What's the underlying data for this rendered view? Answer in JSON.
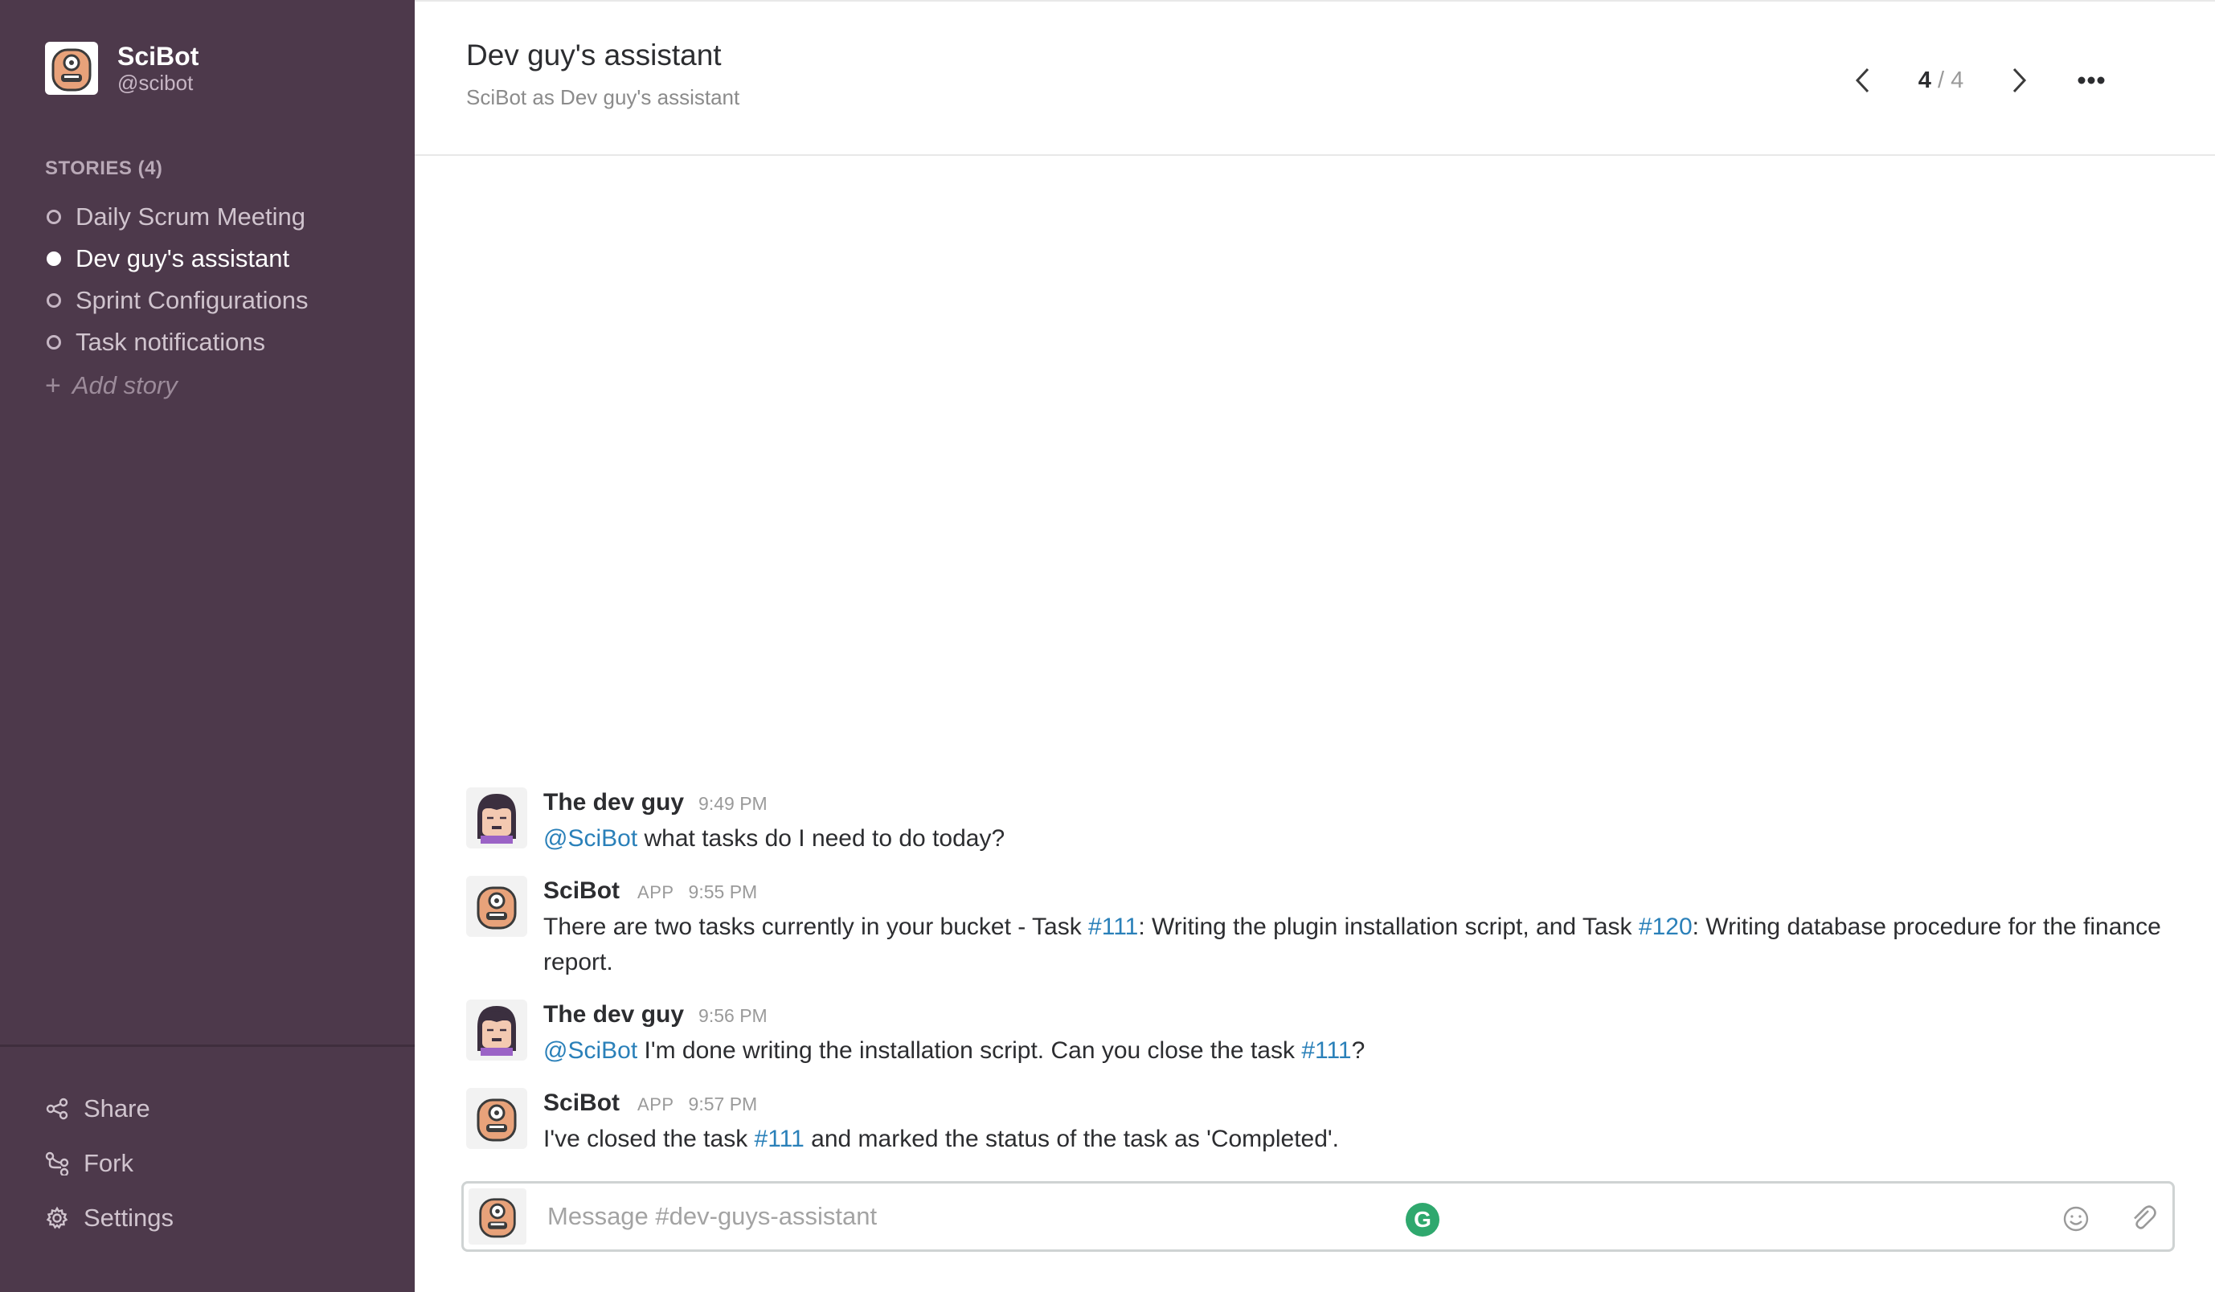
{
  "brand": {
    "name": "SciBot",
    "handle": "@scibot"
  },
  "sidebar": {
    "stories_heading": "STORIES (4)",
    "stories": [
      {
        "label": "Daily Scrum Meeting",
        "active": false
      },
      {
        "label": "Dev guy's assistant",
        "active": true
      },
      {
        "label": "Sprint Configurations",
        "active": false
      },
      {
        "label": "Task notifications",
        "active": false
      }
    ],
    "add_story_label": "Add story",
    "footer": {
      "share_label": "Share",
      "fork_label": "Fork",
      "settings_label": "Settings"
    }
  },
  "header": {
    "title": "Dev guy's assistant",
    "subtitle": "SciBot as Dev guy's assistant",
    "pager": {
      "current": "4",
      "separator_total": " / 4"
    }
  },
  "messages": [
    {
      "author": "The dev guy",
      "app_badge": "",
      "time": "9:49 PM",
      "mention": "@SciBot",
      "text": " what tasks do I need to do today?"
    },
    {
      "author": "SciBot",
      "app_badge": "APP",
      "time": "9:55 PM",
      "part1": "There are two tasks currently in your bucket - Task ",
      "link1": "#111",
      "part2": ": Writing the plugin installation script, and Task ",
      "link2": "#120",
      "part3": ": Writing database procedure for the finance report."
    },
    {
      "author": "The dev guy",
      "app_badge": "",
      "time": "9:56 PM",
      "mention": "@SciBot",
      "part1": " I'm done writing the installation script. Can you close the task ",
      "link1": "#111",
      "part2": "?"
    },
    {
      "author": "SciBot",
      "app_badge": "APP",
      "time": "9:57 PM",
      "part1": "I've closed the task ",
      "link1": "#111",
      "part2": " and marked the status of the task as 'Completed'."
    }
  ],
  "composer": {
    "placeholder": "Message #dev-guys-assistant",
    "grammarly_glyph": "G"
  },
  "icons": {
    "story_dot": "circle-icon",
    "add": "plus-icon",
    "share": "share-icon",
    "fork": "fork-icon",
    "settings": "gear-icon",
    "prev": "chevron-left-icon",
    "next": "chevron-right-icon",
    "more": "ellipsis-icon",
    "emoji": "smiley-icon",
    "attach": "paperclip-icon"
  },
  "colors": {
    "sidebar_bg": "#4d394b",
    "link": "#2a80b9",
    "grammarly": "#2fa86e"
  }
}
